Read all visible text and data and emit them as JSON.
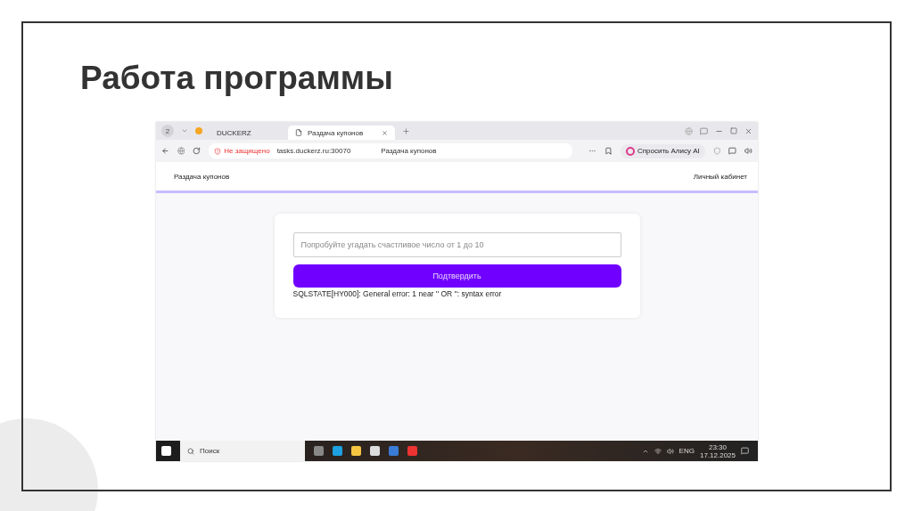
{
  "slide": {
    "title": "Работа программы"
  },
  "browser": {
    "tab_counter": "2",
    "tabs": [
      {
        "label": "DUCKERZ",
        "selected": false
      },
      {
        "label": "Раздача купонов",
        "selected": true
      }
    ],
    "security": "Не защищено",
    "url": "tasks.duckerz.ru:30070",
    "page_title": "Раздача купонов",
    "assistant": "Спросить Алису AI"
  },
  "site": {
    "brand": "Раздача купонов",
    "account_link": "Личный кабинет",
    "guess_field": {
      "placeholder": "Попробуйте угадать счастливое число от 1 до 10"
    },
    "submit_button": "Подтвердить",
    "error": "SQLSTATE[HY000]: General error: 1 near '' OR '': syntax error"
  },
  "taskbar": {
    "search": "Поиск",
    "language": "ENG",
    "time": "23:30",
    "date": "17.12.2025"
  }
}
